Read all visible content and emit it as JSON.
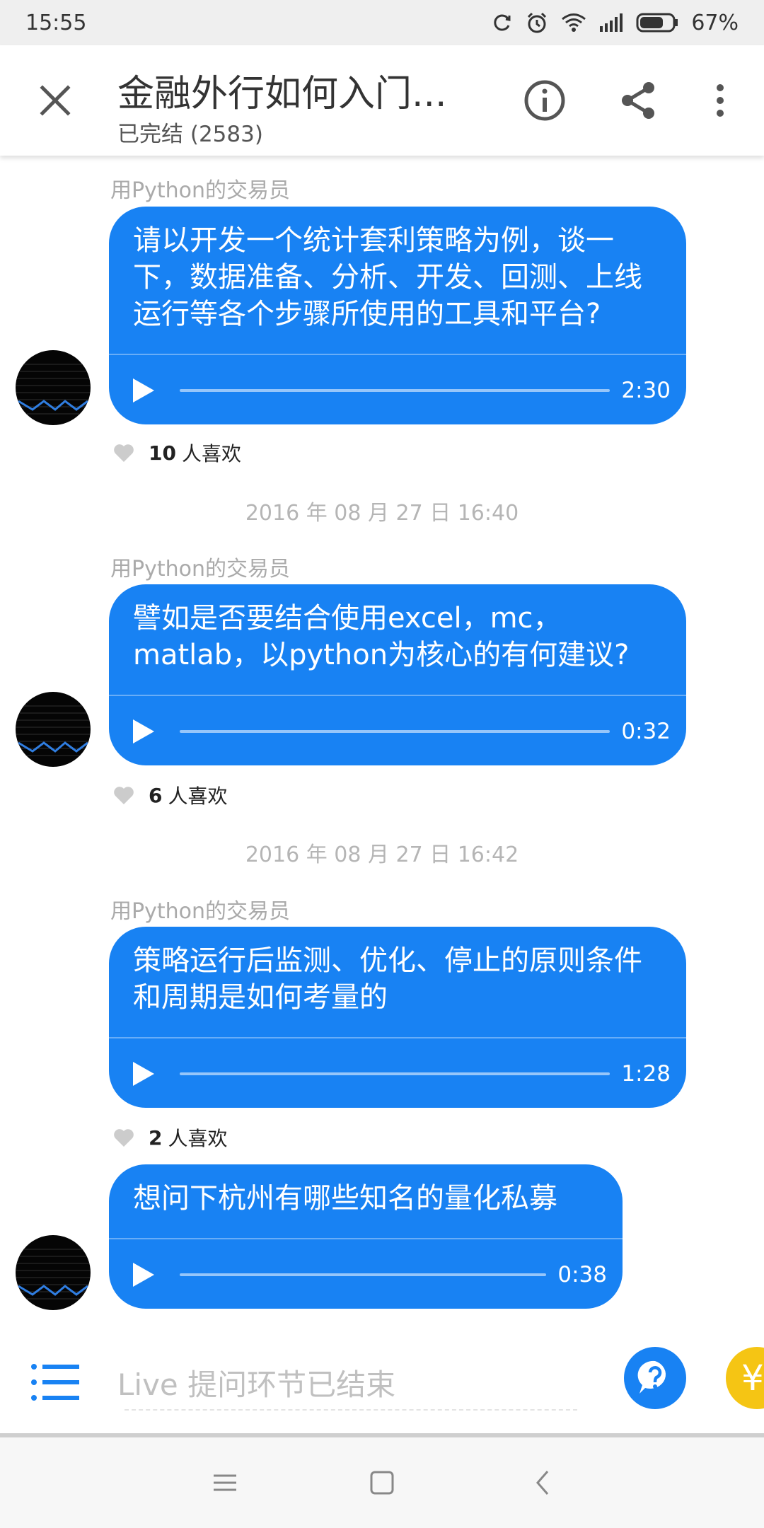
{
  "status_bar": {
    "time": "15:55",
    "battery": "67%",
    "icons": [
      "sync-icon",
      "alarm-icon",
      "wifi-icon",
      "signal-icon",
      "battery-icon"
    ]
  },
  "header": {
    "title": "金融外行如何入门...",
    "subtitle": "已完结 (2583)"
  },
  "messages": [
    {
      "sender": "用Python的交易员",
      "text": "请以开发一个统计套利策略为例，谈一下，数据准备、分析、开发、回测、上线运行等各个步骤所使用的工具和平台?",
      "duration": "2:30",
      "likes_count": "10",
      "likes_suffix": "人喜欢"
    },
    {
      "timestamp": "2016 年 08 月 27 日 16:40",
      "sender": "用Python的交易员",
      "text": "譬如是否要结合使用excel，mc，matlab，以python为核心的有何建议?",
      "duration": "0:32",
      "likes_count": "6",
      "likes_suffix": "人喜欢"
    },
    {
      "timestamp": "2016 年 08 月 27 日 16:42",
      "sender": "用Python的交易员",
      "text": "策略运行后监测、优化、停止的原则条件和周期是如何考量的",
      "duration": "1:28",
      "likes_count": "2",
      "likes_suffix": "人喜欢"
    },
    {
      "text": "想问下杭州有哪些知名的量化私募",
      "duration": "0:38"
    }
  ],
  "input_bar": {
    "placeholder": "Live 提问环节已结束",
    "pay_symbol": "¥"
  },
  "colors": {
    "accent": "#1882f3",
    "pay": "#f5c514"
  }
}
